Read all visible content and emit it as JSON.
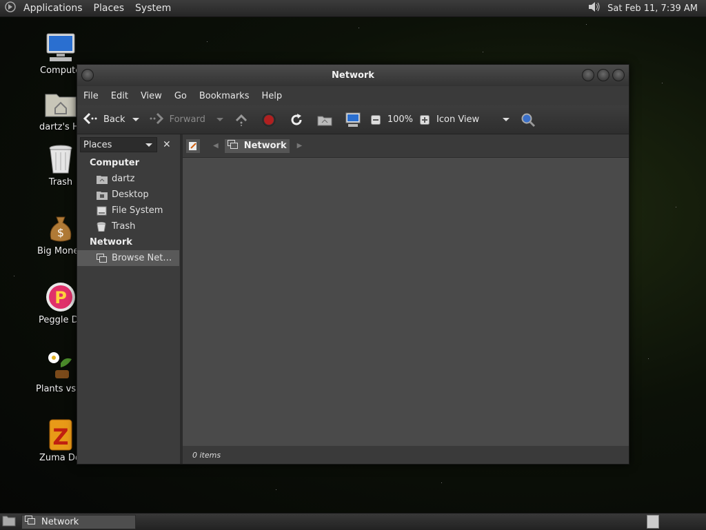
{
  "top_panel": {
    "menus": [
      "Applications",
      "Places",
      "System"
    ],
    "clock": "Sat Feb 11,  7:39 AM"
  },
  "desktop_icons": [
    {
      "label": "Computer",
      "icon": "computer-icon"
    },
    {
      "label": "dartz's Home",
      "icon": "home-folder-icon"
    },
    {
      "label": "Trash",
      "icon": "trash-icon"
    },
    {
      "label": "Big Money Deluxe",
      "icon": "money-bag-icon"
    },
    {
      "label": "Peggle Deluxe",
      "icon": "peggle-icon"
    },
    {
      "label": "Plants vs Zombies",
      "icon": "plants-icon"
    },
    {
      "label": "Zuma Deluxe",
      "icon": "zuma-icon"
    }
  ],
  "window": {
    "title": "Network",
    "menubar": [
      "File",
      "Edit",
      "View",
      "Go",
      "Bookmarks",
      "Help"
    ],
    "toolbar": {
      "back": "Back",
      "forward": "Forward",
      "zoom": "100%",
      "view_mode": "Icon View"
    },
    "sidebar": {
      "combo": "Places",
      "sections": [
        {
          "heading": "Computer",
          "items": [
            {
              "label": "dartz",
              "icon": "home-icon"
            },
            {
              "label": "Desktop",
              "icon": "desktop-icon"
            },
            {
              "label": "File System",
              "icon": "drive-icon"
            },
            {
              "label": "Trash",
              "icon": "trash-icon"
            }
          ]
        },
        {
          "heading": "Network",
          "items": [
            {
              "label": "Browse Net…",
              "icon": "network-icon",
              "selected": true
            }
          ]
        }
      ]
    },
    "pathbar": {
      "crumb": "Network"
    },
    "status": "0 items"
  },
  "bottom_panel": {
    "task": "Network"
  }
}
